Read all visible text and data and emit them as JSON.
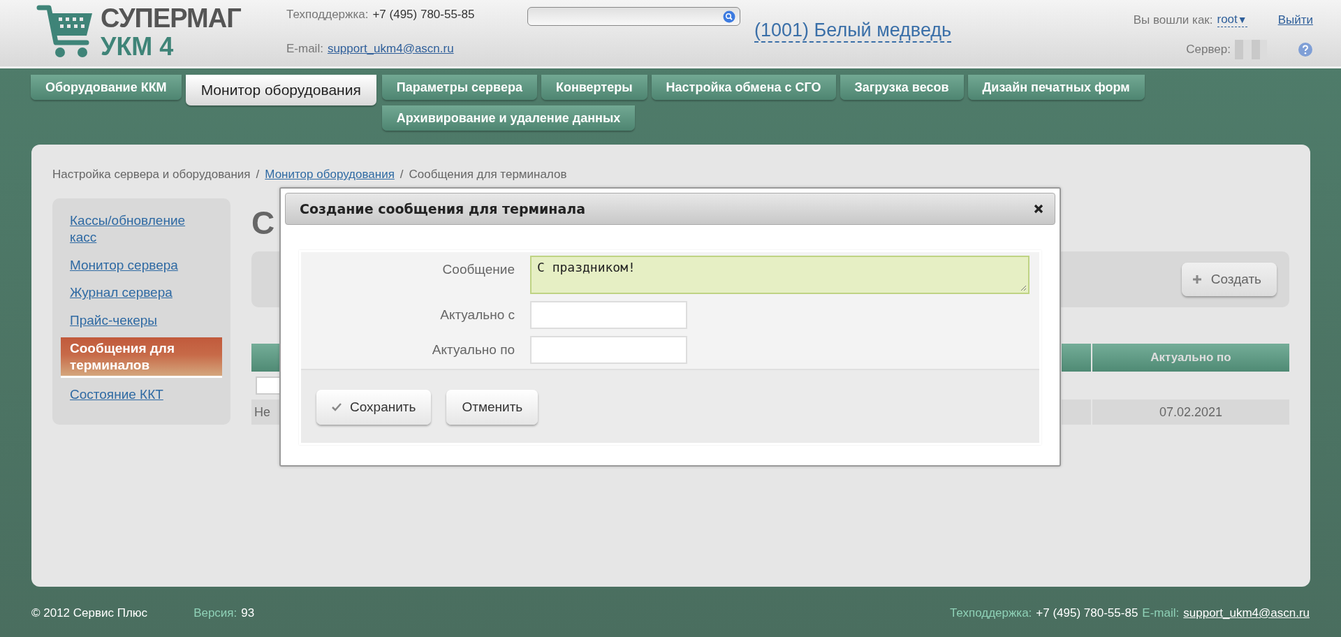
{
  "header": {
    "logo": {
      "line_1": "СУПЕРМАГ",
      "line_2": "УКМ 4"
    },
    "support_label": "Техподдержка:",
    "support_phone": "+7 (495) 780-55-85",
    "email_label": "E-mail:",
    "email": "support_ukm4@ascn.ru",
    "store": "(1001) Белый медведь",
    "login_label": "Вы вошли как:",
    "user": "root",
    "user_caret": "▼",
    "logout": "Выйти",
    "server_label": "Сервер:"
  },
  "tab_groups": [
    {
      "tabs": [
        {
          "label": "Оборудование ККМ",
          "selected": false
        },
        {
          "label": "Монитор оборудования",
          "selected": true
        }
      ]
    },
    {
      "tabs": [
        {
          "label": "Параметры сервера",
          "selected": false
        },
        {
          "label": "Конвертеры",
          "selected": false
        },
        {
          "label": "Настройка обмена с СГО",
          "selected": false
        },
        {
          "label": "Загрузка весов",
          "selected": false
        },
        {
          "label": "Дизайн печатных форм",
          "selected": false
        },
        {
          "label": "Архивирование и удаление данных",
          "selected": false
        }
      ]
    }
  ],
  "breadcrumb": {
    "separator": "/",
    "items": [
      {
        "label": "Настройка сервера и оборудования",
        "link": false
      },
      {
        "label": "Монитор оборудования",
        "link": true
      },
      {
        "label": "Сообщения для терминалов",
        "link": false
      }
    ]
  },
  "sidebar": {
    "items": [
      {
        "label": "Кассы/обновление касс",
        "selected": false
      },
      {
        "label": "Монитор сервера",
        "selected": false
      },
      {
        "label": "Журнал сервера",
        "selected": false
      },
      {
        "label": "Прайс-чекеры",
        "selected": false
      },
      {
        "label": "Сообщения для терминалов",
        "selected": true
      },
      {
        "label": "Состояние ККТ",
        "selected": false
      }
    ]
  },
  "content": {
    "heading": "С",
    "create_button": "Создать",
    "table": {
      "column_last": "Актуально по",
      "rows": [
        {
          "column_1": "Не",
          "column_last": "07.02.2021"
        }
      ]
    }
  },
  "dialog": {
    "title": "Создание сообщения для терминала",
    "fields": [
      {
        "label": "Сообщение",
        "kind": "textarea",
        "value": "С праздником!"
      },
      {
        "label": "Актуально с",
        "kind": "input"
      },
      {
        "label": "Актуально по",
        "kind": "input"
      }
    ],
    "buttons": [
      {
        "label": "Сохранить",
        "kind": "confirm"
      },
      {
        "label": "Отменить",
        "kind": "cancel"
      }
    ]
  },
  "footer": {
    "copyright": "© 2012 Сервис Плюс",
    "version_label": "Версия:",
    "version": "93",
    "support_label": "Техподдержка:",
    "support_phone": "+7 (495) 780-55-85",
    "email_label": "E-mail:",
    "email": "support_ukm4@ascn.ru"
  }
}
